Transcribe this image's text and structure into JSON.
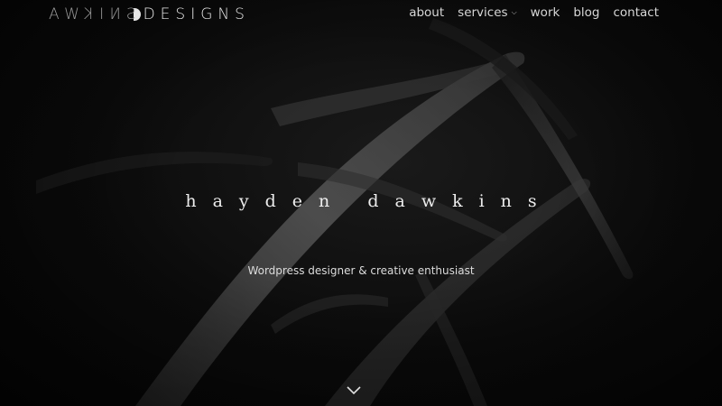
{
  "logo": {
    "mirrored": "SNIKWA",
    "main": "DESIGNS"
  },
  "nav": {
    "items": [
      {
        "label": "about",
        "has_dropdown": false
      },
      {
        "label": "services",
        "has_dropdown": true
      },
      {
        "label": "work",
        "has_dropdown": false
      },
      {
        "label": "blog",
        "has_dropdown": false
      },
      {
        "label": "contact",
        "has_dropdown": false
      }
    ]
  },
  "hero": {
    "title": "hayden dawkins",
    "subtitle": "Wordpress designer & creative enthusiast",
    "scroll_icon": "chevron-down-icon"
  },
  "colors": {
    "background": "#070707",
    "text": "#e8e8e8",
    "muted": "#9a9a9a"
  }
}
